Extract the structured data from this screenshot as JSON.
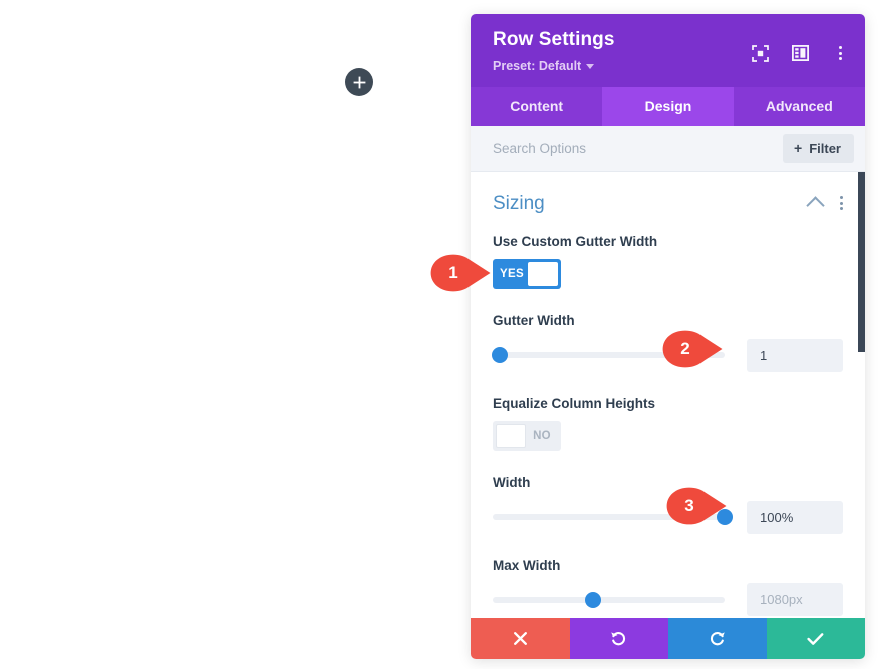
{
  "canvas": {
    "add_button_label": "+"
  },
  "modal": {
    "title": "Row Settings",
    "preset_label": "Preset: Default",
    "header_icons": [
      {
        "name": "focus-icon"
      },
      {
        "name": "layout-panel-icon"
      },
      {
        "name": "more-options-icon"
      }
    ],
    "tabs": [
      {
        "label": "Content",
        "active": false
      },
      {
        "label": "Design",
        "active": true
      },
      {
        "label": "Advanced",
        "active": false
      }
    ],
    "search": {
      "placeholder": "Search Options",
      "value": ""
    },
    "filter_button": {
      "label": "Filter",
      "plus": "+"
    },
    "section": {
      "title": "Sizing",
      "collapse_icon": "chevron-up-icon",
      "menu_icon": "more-options-icon"
    },
    "fields": {
      "use_custom_gutter_width": {
        "label": "Use Custom Gutter Width",
        "toggle_state": "YES"
      },
      "gutter_width": {
        "label": "Gutter Width",
        "value": "1",
        "slider_percent": 3
      },
      "equalize_column_heights": {
        "label": "Equalize Column Heights",
        "toggle_state": "NO"
      },
      "width": {
        "label": "Width",
        "value": "100%",
        "slider_percent": 100
      },
      "max_width": {
        "label": "Max Width",
        "value": "1080px",
        "slider_percent": 43
      }
    },
    "footer": [
      {
        "name": "cancel-button",
        "icon": "close-icon"
      },
      {
        "name": "undo-button",
        "icon": "undo-icon"
      },
      {
        "name": "redo-button",
        "icon": "redo-icon"
      },
      {
        "name": "save-button",
        "icon": "check-icon"
      }
    ]
  },
  "callouts": [
    {
      "number": "1"
    },
    {
      "number": "2"
    },
    {
      "number": "3"
    }
  ],
  "colors": {
    "header_purple": "#7b31cd",
    "tab_bar_purple": "#8638d6",
    "tab_active_purple": "#9b47ea",
    "accent_blue": "#2d8ade",
    "section_title_blue": "#4c8ec4",
    "callout_red": "#ef4a3c",
    "cancel_red": "#ee5d52",
    "undo_purple": "#8c3ae0",
    "redo_blue": "#2c8ad8",
    "save_green": "#2cb998",
    "scrollbar_dark": "#3b4757"
  }
}
